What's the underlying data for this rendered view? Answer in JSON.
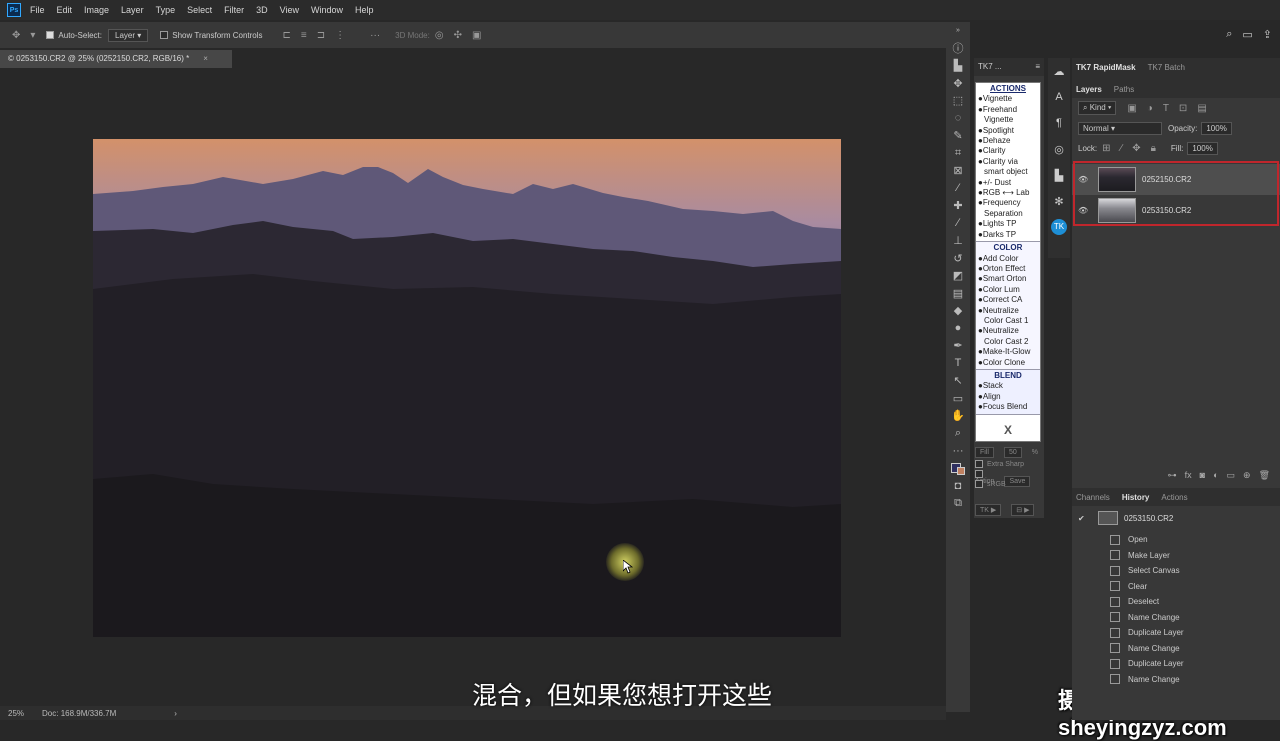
{
  "menu": [
    "File",
    "Edit",
    "Image",
    "Layer",
    "Type",
    "Select",
    "Filter",
    "3D",
    "View",
    "Window",
    "Help"
  ],
  "options": {
    "auto_select": "Auto-Select:",
    "layer_select": "Layer",
    "show_transform": "Show Transform Controls",
    "mode_3d": "3D Mode:"
  },
  "doc": {
    "tab": "© 0253150.CR2 @ 25% (0252150.CR2, RGB/16) *",
    "close": "×"
  },
  "status": {
    "zoom": "25%",
    "doc": "Doc: 168.9M/336.7M"
  },
  "subtitle": "混合，但如果您想打开这些",
  "watermark": "摄影前沿sheyingzyz.com",
  "tk7": {
    "title": "TK7 ...",
    "actions_head": "ACTIONS",
    "actions": [
      "●Vignette",
      "●Freehand",
      "  Vignette",
      "●Spotlight",
      "●Dehaze",
      "●Clarity",
      "●Clarity via",
      "  smart object",
      "●+/- Dust",
      "●RGB ⟷ Lab",
      "●Frequency",
      "  Separation",
      "●Lights TP",
      "●Darks TP"
    ],
    "color_head": "COLOR",
    "color": [
      "●Add Color",
      "●Orton Effect",
      "●Smart Orton",
      "●Color Lum",
      "●Correct CA",
      "●Neutralize",
      "  Color Cast 1",
      "●Neutralize",
      "  Color Cast 2",
      "●Make-It-Glow",
      "●Color Clone"
    ],
    "blend_head": "BLEND",
    "blend": [
      "●Stack",
      "●Align",
      "●Focus Blend"
    ],
    "close": "X",
    "fill": "Fill",
    "opacity": "50",
    "extra_sharp": "Extra Sharp",
    "action": "Action",
    "srgb": "sRGB",
    "save": "Save",
    "tk": "TK ▶"
  },
  "right": {
    "tab1": "TK7 RapidMask",
    "tab2": "TK7 Batch",
    "layers_tab": "Layers",
    "paths_tab": "Paths",
    "kind": "Kind",
    "blend_mode": "Normal",
    "opacity_label": "Opacity:",
    "opacity": "100%",
    "lock_label": "Lock:",
    "fill_label": "Fill:",
    "fill": "100%",
    "layers": [
      "0252150.CR2",
      "0253150.CR2"
    ],
    "channels_tab": "Channels",
    "history_tab": "History",
    "actions_tab": "Actions",
    "history_snapshot": "0253150.CR2",
    "history": [
      "Open",
      "Make Layer",
      "Select Canvas",
      "Clear",
      "Deselect",
      "Name Change",
      "Duplicate Layer",
      "Name Change",
      "Duplicate Layer",
      "Name Change"
    ]
  }
}
